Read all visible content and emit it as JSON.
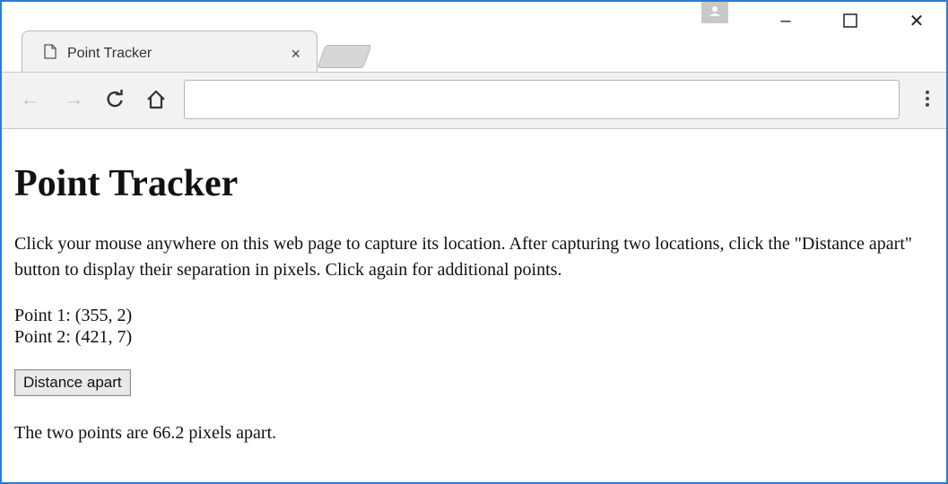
{
  "browser": {
    "tab": {
      "title": "Point Tracker",
      "close_glyph": "×"
    },
    "window_controls": {
      "minimize": "–",
      "maximize": "☐",
      "close": "✕"
    },
    "toolbar": {
      "back_glyph": "←",
      "forward_glyph": "→",
      "reload_glyph": "C",
      "home_glyph": "⌂",
      "address_value": "",
      "address_placeholder": ""
    }
  },
  "page": {
    "heading": "Point Tracker",
    "intro": "Click your mouse anywhere on this web page to capture its location. After capturing two locations, click the \"Distance apart\" button to display their separation in pixels. Click again for additional points.",
    "point1": "Point 1: (355, 2)",
    "point2": "Point 2: (421, 7)",
    "button_label": "Distance apart",
    "result": "The two points are 66.2 pixels apart."
  },
  "colors": {
    "window_border": "#2b7bd8",
    "toolbar_bg": "#f2f2f2"
  }
}
